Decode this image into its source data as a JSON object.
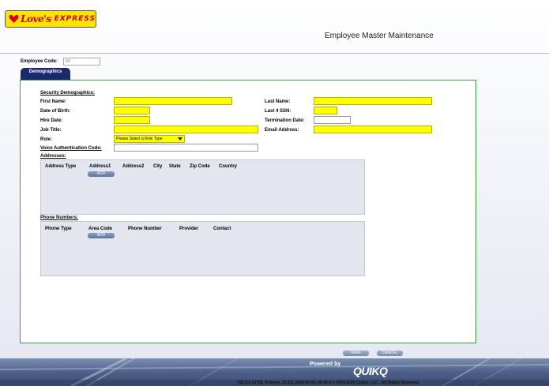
{
  "header": {
    "logo_word": "Love's",
    "logo_express": "EXPRESS",
    "page_title": "Employee Master Maintenance"
  },
  "employee_code": {
    "label": "Employee Code:",
    "value": "83"
  },
  "tabs": [
    {
      "label": "Demographics",
      "active": true
    }
  ],
  "form": {
    "section_title": "Security Demographics:",
    "first_name_label": "First Name:",
    "last_name_label": "Last Name:",
    "dob_label": "Date of Birth:",
    "last4ssn_label": "Last 4 SSN:",
    "hire_date_label": "Hire Date:",
    "termination_date_label": "Termination Date:",
    "job_title_label": "Job Title:",
    "email_label": "Email Address:",
    "role_label": "Role:",
    "role_selected": "Please Select a Role Type",
    "voice_auth_label": "Voice Authentication Code:"
  },
  "addresses": {
    "title": "Addresses:",
    "columns": [
      "Address Type",
      "Address1",
      "Address2",
      "City",
      "State",
      "Zip Code",
      "Country"
    ],
    "add_label": "ADD"
  },
  "phones": {
    "title": "Phone Numbers:",
    "columns": [
      "Phone Type",
      "Area Code",
      "Phone Number",
      "Provider",
      "Contact"
    ],
    "add_label": "ADD"
  },
  "actions": {
    "save_label": "SAVE",
    "cancel_label": "CANCEL"
  },
  "footer": {
    "powered_by": "Powered by",
    "brand": "QUIKQ",
    "version": "V20.8.5.16758, Release, 20.8.5, 2020-09-03, 08:56:4 © 2009-2020 QuikQ, LLC - All Rights Reserved."
  },
  "colors": {
    "required_field": "#ffff00",
    "tab_bg": "#1c2a6b",
    "panel_border": "#3d9a3d",
    "brand_red": "#d6001c",
    "logo_yellow": "#ffe400"
  }
}
